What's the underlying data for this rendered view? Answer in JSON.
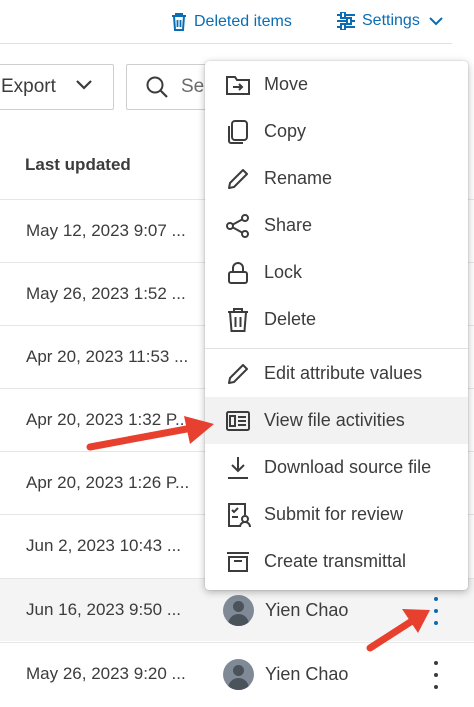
{
  "toolbar": {
    "deleted_items": "Deleted items",
    "settings": "Settings",
    "export": "Export",
    "search_partial": "Se"
  },
  "table": {
    "header_last_updated": "Last updated",
    "rows": [
      {
        "date": "May 12, 2023 9:07 ..."
      },
      {
        "date": "May 26, 2023 1:52 ..."
      },
      {
        "date": "Apr 20, 2023 11:53 ..."
      },
      {
        "date": "Apr 20, 2023 1:32 P..."
      },
      {
        "date": "Apr 20, 2023 1:26 P..."
      },
      {
        "date": "Jun 2, 2023 10:43 ..."
      },
      {
        "date": "Jun 16, 2023 9:50 ...",
        "user": "Yien Chao"
      },
      {
        "date": "May 26, 2023 9:20 ...",
        "user": "Yien Chao"
      }
    ]
  },
  "menu": {
    "items": [
      {
        "label": "Move",
        "icon": "folder-move-icon"
      },
      {
        "label": "Copy",
        "icon": "copy-icon"
      },
      {
        "label": "Rename",
        "icon": "pencil-icon"
      },
      {
        "label": "Share",
        "icon": "share-icon"
      },
      {
        "label": "Lock",
        "icon": "lock-icon"
      },
      {
        "label": "Delete",
        "icon": "trash-icon"
      },
      {
        "label": "Edit attribute values",
        "icon": "pencil-icon"
      },
      {
        "label": "View file activities",
        "icon": "activity-list-icon"
      },
      {
        "label": "Download source file",
        "icon": "download-icon"
      },
      {
        "label": "Submit for review",
        "icon": "review-doc-icon"
      },
      {
        "label": "Create transmittal",
        "icon": "transmittal-icon"
      }
    ]
  },
  "colors": {
    "link_blue": "#0a6db3",
    "arrow_red": "#e8402f",
    "text": "#3c3c3c",
    "hover_bg": "#f2f2f2"
  }
}
